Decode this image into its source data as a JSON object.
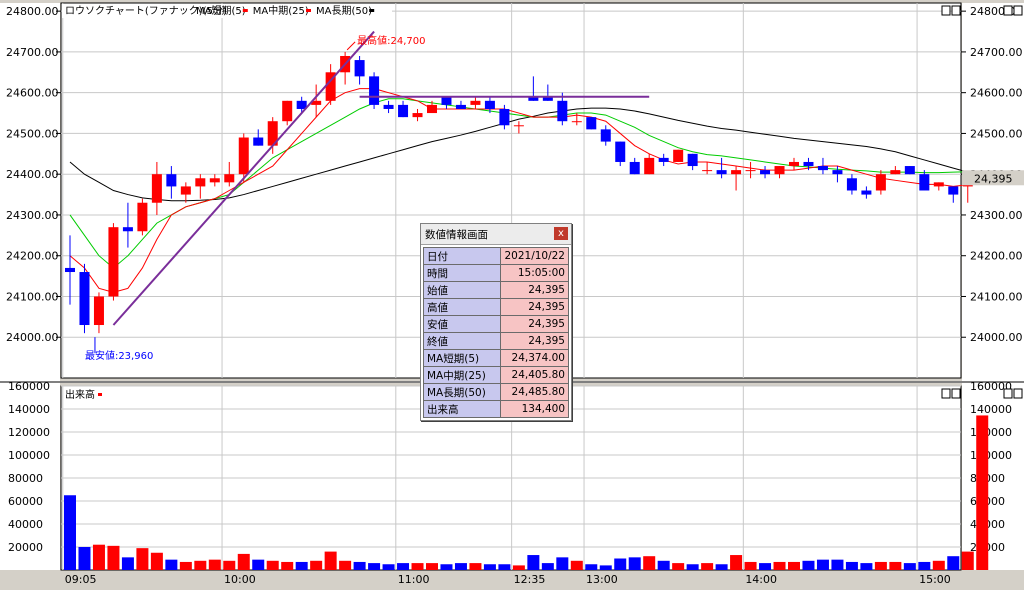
{
  "legend": {
    "title": "ロウソクチャート(ファナック)(5分)",
    "items": [
      {
        "label": "MA短期(5)",
        "color": "#ff0000"
      },
      {
        "label": "MA中期(25)",
        "color": "#ff0000"
      },
      {
        "label": "MA長期(50)",
        "color": "#000000"
      }
    ]
  },
  "price_axis_labels": [
    "24800.00",
    "24700.00",
    "24600.00",
    "24500.00",
    "24400.00",
    "24300.00",
    "24200.00",
    "24100.00",
    "24000.00"
  ],
  "volume_axis_labels": [
    "160000",
    "140000",
    "120000",
    "100000",
    "80000",
    "60000",
    "40000",
    "20000"
  ],
  "volume_legend": "出来高",
  "current_price_tag": "24,395",
  "time_labels": [
    "09:05",
    "10:00",
    "11:00",
    "12:35",
    "13:00",
    "14:00",
    "15:00"
  ],
  "annotations": {
    "high": "最高値:24,700",
    "low": "最安値:23,960"
  },
  "info_panel": {
    "title": "数値情報画面",
    "close_label": "x",
    "rows": [
      {
        "k": "日付",
        "v": "2021/10/22"
      },
      {
        "k": "時間",
        "v": "15:05:00"
      },
      {
        "k": "始値",
        "v": "24,395"
      },
      {
        "k": "高値",
        "v": "24,395"
      },
      {
        "k": "安値",
        "v": "24,395"
      },
      {
        "k": "終値",
        "v": "24,395"
      },
      {
        "k": "MA短期(5)",
        "v": "24,374.00"
      },
      {
        "k": "MA中期(25)",
        "v": "24,405.80"
      },
      {
        "k": "MA長期(50)",
        "v": "24,485.80"
      },
      {
        "k": "出来高",
        "v": "134,400"
      }
    ]
  },
  "colors": {
    "up": "#ff0000",
    "down": "#0000ff",
    "ma_short": "#ff0000",
    "ma_mid": "#00cc00",
    "ma_long": "#000000",
    "trendline": "#7a2e9a"
  },
  "chart_data": {
    "type": "candlestick",
    "ylim": [
      23900,
      24820
    ],
    "volume_ylim": [
      0,
      160000
    ],
    "candles": [
      [
        24170,
        24250,
        24080,
        24160
      ],
      [
        24160,
        24180,
        24010,
        24030
      ],
      [
        24030,
        24110,
        24010,
        24100
      ],
      [
        24100,
        24280,
        24090,
        24270
      ],
      [
        24270,
        24330,
        24220,
        24260
      ],
      [
        24260,
        24340,
        24250,
        24330
      ],
      [
        24330,
        24430,
        24300,
        24400
      ],
      [
        24400,
        24420,
        24340,
        24370
      ],
      [
        24350,
        24380,
        24330,
        24370
      ],
      [
        24370,
        24400,
        24340,
        24390
      ],
      [
        24380,
        24400,
        24370,
        24390
      ],
      [
        24380,
        24430,
        24370,
        24400
      ],
      [
        24400,
        24500,
        24380,
        24490
      ],
      [
        24490,
        24510,
        24470,
        24470
      ],
      [
        24470,
        24540,
        24450,
        24530
      ],
      [
        24530,
        24580,
        24520,
        24580
      ],
      [
        24580,
        24590,
        24550,
        24560
      ],
      [
        24570,
        24620,
        24540,
        24580
      ],
      [
        24580,
        24670,
        24570,
        24650
      ],
      [
        24650,
        24700,
        24620,
        24690
      ],
      [
        24680,
        24690,
        24620,
        24640
      ],
      [
        24640,
        24650,
        24560,
        24570
      ],
      [
        24570,
        24580,
        24550,
        24560
      ],
      [
        24570,
        24580,
        24540,
        24540
      ],
      [
        24540,
        24560,
        24530,
        24550
      ],
      [
        24550,
        24580,
        24550,
        24570
      ],
      [
        24590,
        24590,
        24560,
        24570
      ],
      [
        24570,
        24580,
        24560,
        24560
      ],
      [
        24570,
        24590,
        24560,
        24580
      ],
      [
        24580,
        24590,
        24550,
        24560
      ],
      [
        24560,
        24570,
        24510,
        24520
      ],
      [
        24520,
        24530,
        24500,
        24520
      ],
      [
        24590,
        24640,
        24580,
        24580
      ],
      [
        24590,
        24620,
        24580,
        24580
      ],
      [
        24580,
        24600,
        24520,
        24530
      ],
      [
        24530,
        24550,
        24520,
        24530
      ],
      [
        24540,
        24540,
        24510,
        24510
      ],
      [
        24510,
        24520,
        24470,
        24480
      ],
      [
        24480,
        24480,
        24420,
        24430
      ],
      [
        24430,
        24440,
        24400,
        24400
      ],
      [
        24400,
        24450,
        24400,
        24440
      ],
      [
        24440,
        24450,
        24420,
        24430
      ],
      [
        24430,
        24460,
        24430,
        24460
      ],
      [
        24450,
        24450,
        24410,
        24420
      ],
      [
        24410,
        24430,
        24400,
        24410
      ],
      [
        24410,
        24440,
        24390,
        24400
      ],
      [
        24400,
        24420,
        24360,
        24410
      ],
      [
        24410,
        24430,
        24390,
        24410
      ],
      [
        24410,
        24420,
        24390,
        24400
      ],
      [
        24400,
        24420,
        24390,
        24420
      ],
      [
        24420,
        24440,
        24410,
        24430
      ],
      [
        24430,
        24440,
        24410,
        24420
      ],
      [
        24420,
        24440,
        24400,
        24410
      ],
      [
        24410,
        24420,
        24380,
        24400
      ],
      [
        24390,
        24400,
        24350,
        24360
      ],
      [
        24360,
        24370,
        24340,
        24350
      ],
      [
        24360,
        24410,
        24350,
        24400
      ],
      [
        24400,
        24420,
        24400,
        24410
      ],
      [
        24420,
        24420,
        24400,
        24400
      ],
      [
        24400,
        24410,
        24360,
        24360
      ],
      [
        24370,
        24380,
        24360,
        24380
      ],
      [
        24370,
        24370,
        24330,
        24350
      ],
      [
        24370,
        24390,
        24330,
        24390
      ]
    ],
    "volume": [
      65000,
      20000,
      22000,
      21000,
      11000,
      19000,
      15000,
      9000,
      7000,
      8000,
      9000,
      8000,
      14000,
      9000,
      8000,
      7000,
      7000,
      8000,
      16000,
      8000,
      7000,
      6000,
      5000,
      6000,
      6000,
      6000,
      5000,
      6000,
      6000,
      5000,
      5000,
      4000,
      13000,
      6000,
      11000,
      8000,
      5000,
      4000,
      10000,
      11000,
      12000,
      8000,
      6000,
      5000,
      6000,
      5000,
      13000,
      7000,
      6000,
      7000,
      7000,
      8000,
      9000,
      9000,
      7000,
      6000,
      7000,
      7000,
      6000,
      7000,
      8000,
      12000,
      16000,
      134400
    ],
    "ma_short": [
      24200,
      24170,
      24120,
      24110,
      24120,
      24170,
      24240,
      24300,
      24320,
      24330,
      24340,
      24360,
      24380,
      24400,
      24420,
      24460,
      24500,
      24540,
      24580,
      24600,
      24610,
      24610,
      24600,
      24590,
      24580,
      24560,
      24560,
      24560,
      24560,
      24560,
      24560,
      24550,
      24540,
      24540,
      24540,
      24545,
      24540,
      24530,
      24500,
      24470,
      24450,
      24435,
      24425,
      24430,
      24430,
      24425,
      24420,
      24415,
      24410,
      24410,
      24410,
      24415,
      24420,
      24420,
      24410,
      24400,
      24390,
      24385,
      24380,
      24375,
      24375,
      24370,
      24374
    ],
    "ma_mid": [
      24300,
      24250,
      24200,
      24170,
      24200,
      24240,
      24280,
      24300,
      24320,
      24330,
      24340,
      24350,
      24380,
      24410,
      24440,
      24460,
      24480,
      24500,
      24520,
      24540,
      24560,
      24575,
      24585,
      24585,
      24580,
      24575,
      24570,
      24565,
      24560,
      24555,
      24550,
      24545,
      24540,
      24540,
      24545,
      24550,
      24550,
      24545,
      24530,
      24515,
      24495,
      24480,
      24465,
      24455,
      24448,
      24445,
      24440,
      24435,
      24430,
      24425,
      24420,
      24418,
      24415,
      24412,
      24410,
      24408,
      24405,
      24405,
      24405,
      24404,
      24404,
      24405,
      24406
    ],
    "ma_long": [
      24430,
      24400,
      24380,
      24360,
      24350,
      24342,
      24338,
      24335,
      24335,
      24336,
      24338,
      24342,
      24350,
      24360,
      24370,
      24380,
      24390,
      24400,
      24410,
      24420,
      24430,
      24440,
      24450,
      24460,
      24470,
      24480,
      24488,
      24496,
      24505,
      24515,
      24525,
      24535,
      24542,
      24550,
      24555,
      24560,
      24562,
      24562,
      24560,
      24555,
      24548,
      24540,
      24532,
      24525,
      24518,
      24512,
      24508,
      24503,
      24498,
      24493,
      24488,
      24484,
      24480,
      24476,
      24472,
      24468,
      24462,
      24455,
      24445,
      24435,
      24425,
      24415,
      24405
    ],
    "trendline": [
      [
        3,
        24030
      ],
      [
        21,
        24750
      ]
    ],
    "resistance": [
      [
        20,
        24590
      ],
      [
        40,
        24590
      ]
    ],
    "high_marker_index": 19,
    "low_marker_index": 2
  }
}
